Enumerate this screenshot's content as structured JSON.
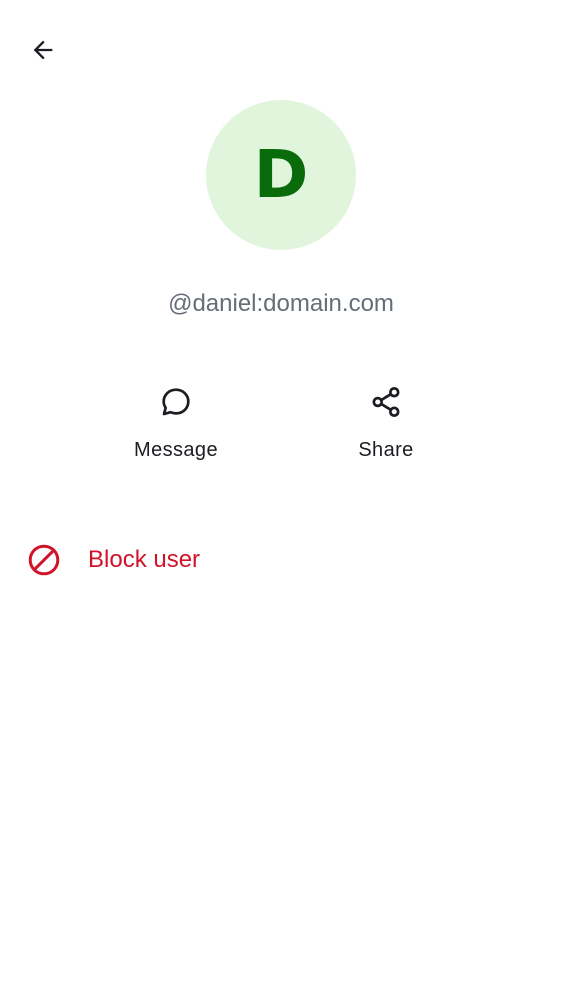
{
  "toolbar": {
    "back_icon": "arrow-left-icon"
  },
  "profile": {
    "avatar_letter": "D",
    "avatar_bg_color": "#e0f5dc",
    "avatar_text_color": "#0a6b0a",
    "user_id": "@daniel:domain.com"
  },
  "actions": [
    {
      "label": "Message",
      "icon": "chat-bubble-icon"
    },
    {
      "label": "Share",
      "icon": "share-icon"
    }
  ],
  "block": {
    "label": "Block user",
    "icon": "block-icon",
    "color": "#d1132a"
  }
}
